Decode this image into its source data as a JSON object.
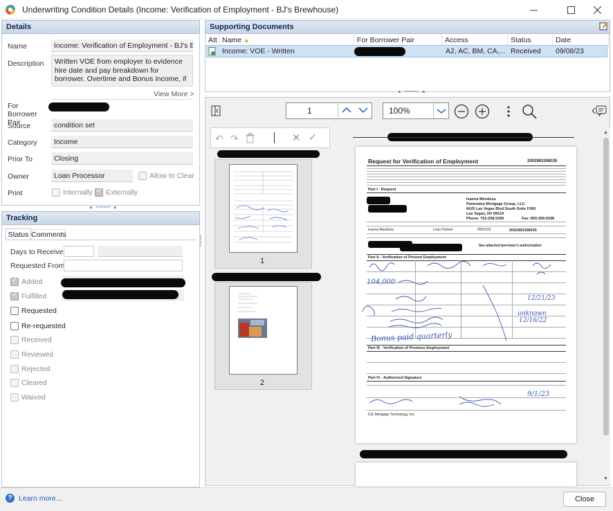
{
  "window": {
    "title": "Underwriting Condition Details (Income: Verification of Employment - BJ's Brewhouse)"
  },
  "details": {
    "header": "Details",
    "name_label": "Name",
    "name_value": "Income: Verification of Employment - BJ's Brewhouse",
    "description_label": "Description",
    "description_value": "Written VOE from employer to evidence hire date and pay breakdown for borrower. Overtime and Bonus income, if",
    "view_more": "View More >",
    "borrower_pair_label": "For Borrower Pair",
    "source_label": "Source",
    "source_value": "condition set",
    "category_label": "Category",
    "category_value": "Income",
    "prior_to_label": "Prior To",
    "prior_to_value": "Closing",
    "owner_label": "Owner",
    "owner_value": "Loan Processor",
    "allow_to_clear": "Allow to Clear",
    "print_label": "Print",
    "internally": "Internally",
    "externally": "Externally"
  },
  "tracking": {
    "header": "Tracking",
    "tabs": [
      "Status",
      "Comments"
    ],
    "days_to_receive_label": "Days to Receive",
    "requested_from_label": "Requested From",
    "added_label": "Added",
    "fulfilled_label": "Fulfilled",
    "statuses": [
      "Requested",
      "Re-requested",
      "Received",
      "Reviewed",
      "Rejected",
      "Cleared",
      "Waived"
    ]
  },
  "supporting": {
    "header": "Supporting Documents",
    "columns": [
      "Att",
      "Name",
      "For Borrower Pair",
      "Access",
      "Status",
      "Date"
    ],
    "rows": [
      {
        "name": "Income: VOE - Written",
        "access": "A2, AC, BM, CA,...",
        "status": "Received",
        "date": "09/08/23"
      }
    ]
  },
  "viewer": {
    "page_number": "1",
    "zoom": "100%",
    "thumb_labels": [
      "1",
      "2"
    ]
  },
  "document": {
    "title": "Request for Verification of Employment",
    "doc_number": "2002983308035",
    "part1": "Part I - Request",
    "lender_name": "Ivanna Mendoza",
    "lender_company": "Panorama Mortgage Group, LLC",
    "lender_address": "6625 Las Vegas Blvd South Suite F260",
    "lender_city": "Las Vegas, NV 89119",
    "lender_phone": "Phone: 702-258-5296",
    "lender_fax": "Fax: 800-258-5298",
    "lender_loan_no": "2002983308035",
    "lender_title": "Loan Partner",
    "lender_date": "09/01/23",
    "lender_signer": "Ivanna Mendoza",
    "auth_note": "See attached borrower's authorization",
    "part2": "Part II - Verification of Present Employment",
    "part3": "Part III - Verification of Previous Employment",
    "part4": "Part IV - Authorized Signature",
    "footer": "ICE Mortgage Technology, Inc.",
    "hw_base": "104,000",
    "hw_bonus": "Bonus paid quarterly",
    "hw_date1": "12/21/23",
    "hw_unknown": "unknown",
    "hw_date2": "12/16/22",
    "hw_date3": "9/1/23"
  },
  "footer": {
    "learn_more": "Learn more...",
    "close": "Close"
  }
}
